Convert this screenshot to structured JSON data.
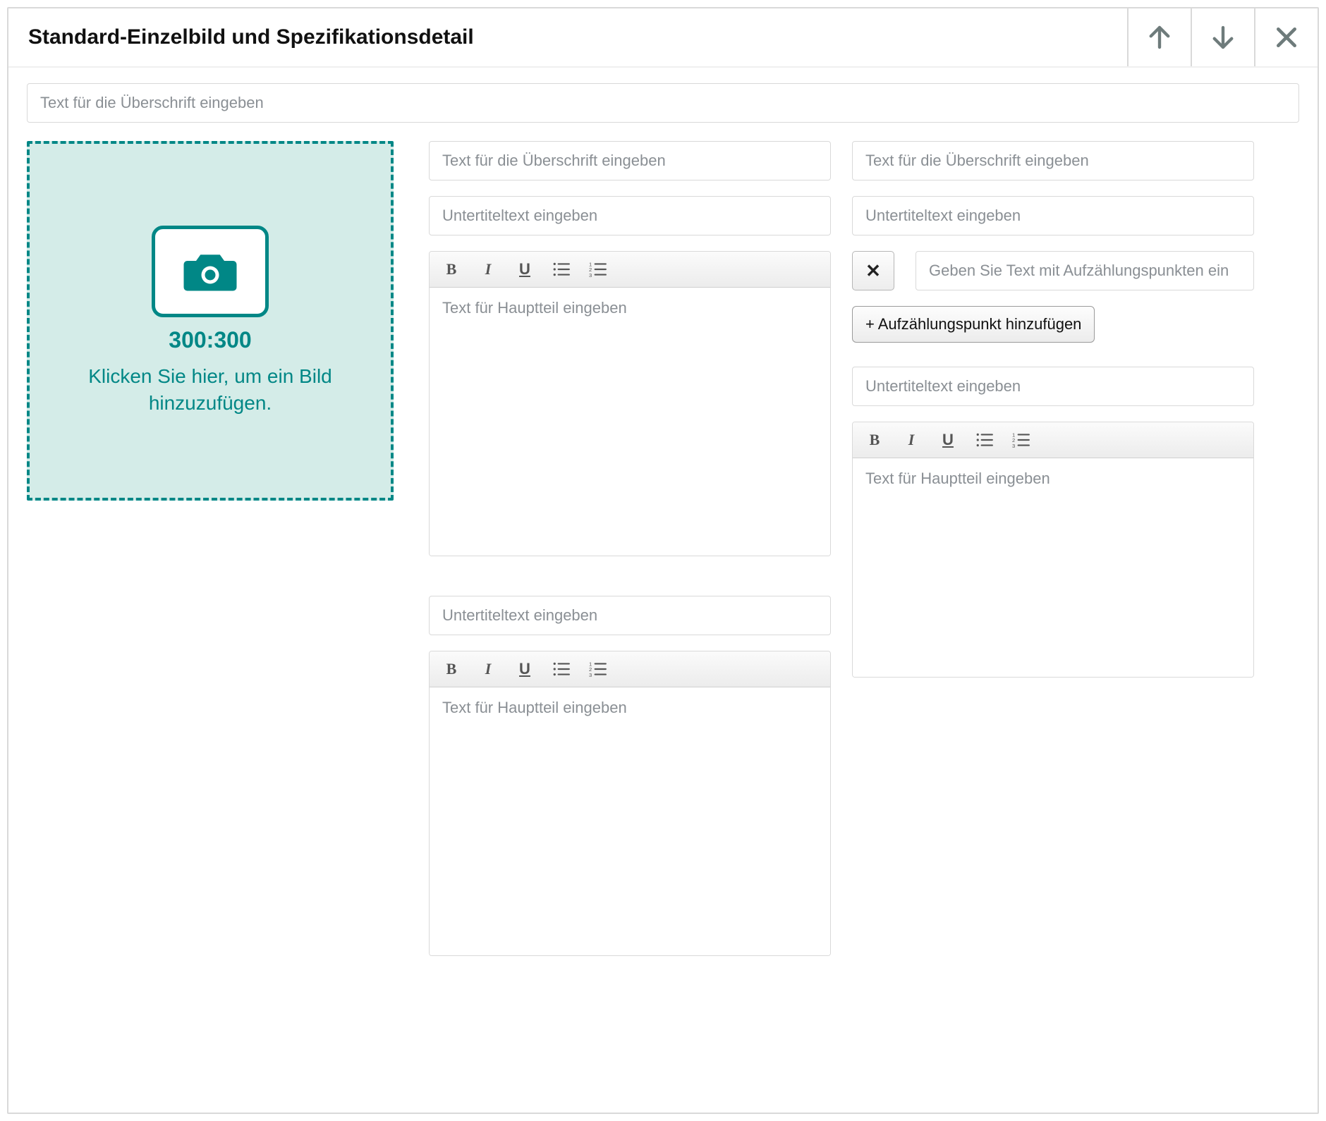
{
  "header": {
    "title": "Standard-Einzelbild und Spezifikationsdetail"
  },
  "top_input": {
    "placeholder": "Text für die Überschrift eingeben"
  },
  "image_drop": {
    "ratio": "300:300",
    "text": "Klicken Sie hier, um ein Bild hinzuzufügen."
  },
  "col_mid": {
    "heading_placeholder": "Text für die Überschrift eingeben",
    "subtitle1_placeholder": "Untertiteltext eingeben",
    "body1_placeholder": "Text für Hauptteil eingeben",
    "subtitle2_placeholder": "Untertiteltext eingeben",
    "body2_placeholder": "Text für Hauptteil eingeben"
  },
  "col_right": {
    "heading_placeholder": "Text für die Überschrift eingeben",
    "subtitle1_placeholder": "Untertiteltext eingeben",
    "bullet_placeholder": "Geben Sie Text mit Aufzählungspunkten ein",
    "remove_label": "✕",
    "add_label": "+ Aufzählungspunkt hinzufügen",
    "subtitle2_placeholder": "Untertiteltext eingeben",
    "body_placeholder": "Text für Hauptteil eingeben"
  },
  "rte_buttons": {
    "bold": "B",
    "italic": "I",
    "underline": "U"
  }
}
